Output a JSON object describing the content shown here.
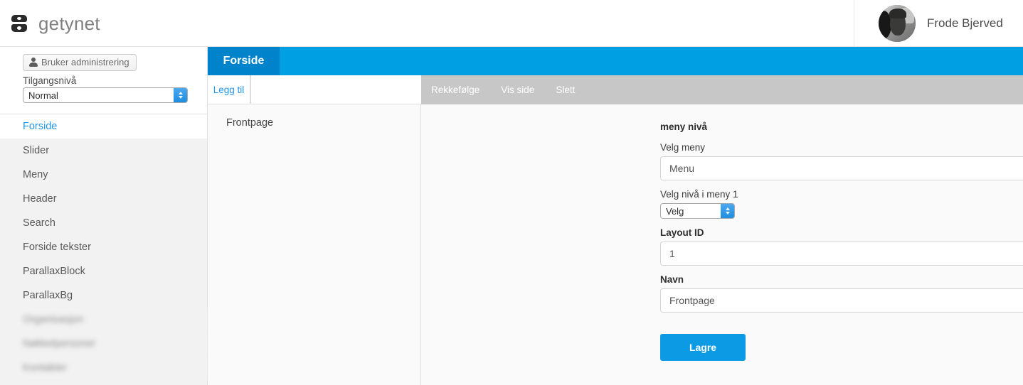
{
  "topbar": {
    "brand_name": "getynet",
    "logo_icon": "getynet-logo-icon",
    "user_name": "Frode Bjerved",
    "avatar_icon": "user-avatar"
  },
  "sidebar": {
    "admin_button_label": "Bruker administrering",
    "admin_button_icon": "person-icon",
    "access_level_label": "Tilgangsnivå",
    "access_level_value": "Normal",
    "access_level_options": [
      "Normal"
    ],
    "items": [
      {
        "label": "Forside",
        "active": true,
        "blurred": false
      },
      {
        "label": "Slider",
        "active": false,
        "blurred": false
      },
      {
        "label": "Meny",
        "active": false,
        "blurred": false
      },
      {
        "label": "Header",
        "active": false,
        "blurred": false
      },
      {
        "label": "Search",
        "active": false,
        "blurred": false
      },
      {
        "label": "Forside tekster",
        "active": false,
        "blurred": false
      },
      {
        "label": "ParallaxBlock",
        "active": false,
        "blurred": false
      },
      {
        "label": "ParallaxBg",
        "active": false,
        "blurred": false
      },
      {
        "label": "Organisasjon",
        "active": false,
        "blurred": true
      },
      {
        "label": "Nøkkelpersoner",
        "active": false,
        "blurred": true
      },
      {
        "label": "Kontakter",
        "active": false,
        "blurred": true
      }
    ]
  },
  "content": {
    "active_tab": "Forside",
    "sub_tab": "Legg til",
    "toolbar": {
      "order_label": "Rekkefølge",
      "view_page_label": "Vis side",
      "delete_label": "Slett"
    },
    "list": {
      "items": [
        {
          "label": "Frontpage"
        }
      ]
    },
    "form": {
      "group_title": "meny nivå",
      "menu_label": "Velg meny",
      "menu_value": "Menu",
      "menu_options": [
        "Menu"
      ],
      "level_label": "Velg nivå i meny 1",
      "level_value": "Velg",
      "level_options": [
        "Velg"
      ],
      "layout_id_label": "Layout ID",
      "layout_id_value": "1",
      "name_label": "Navn",
      "name_value": "Frontpage",
      "save_label": "Lagre"
    }
  },
  "colors": {
    "accent_blue": "#009ee3",
    "tab_active_blue": "#0083ca",
    "link_blue": "#2196f3",
    "save_button": "#0d9ae5",
    "toolbar_gray": "#c7c7c7",
    "sidebar_gray": "#f2f2f2"
  }
}
